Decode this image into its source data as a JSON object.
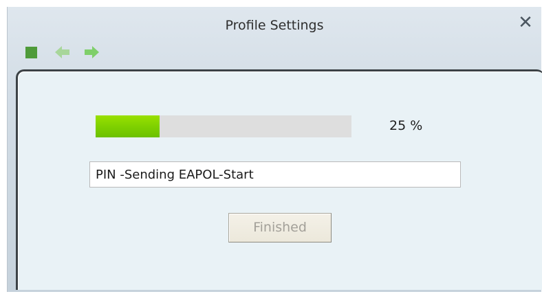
{
  "window": {
    "title": "Profile Settings",
    "close_icon": "close-icon",
    "close_symbol": "✕"
  },
  "toolbar": {
    "items": [
      {
        "icon": "stop-icon",
        "color": "#4f9b3a"
      },
      {
        "icon": "back-arrow-icon",
        "color": "#a8d69a"
      },
      {
        "icon": "forward-arrow-icon",
        "color": "#7fcf6a"
      }
    ]
  },
  "progress": {
    "fraction": 0.25,
    "percent_label": "25 %",
    "fill_color": "#7fd100"
  },
  "status": {
    "value": "PIN -Sending EAPOL-Start"
  },
  "actions": {
    "finished_label": "Finished",
    "finished_enabled": false
  }
}
